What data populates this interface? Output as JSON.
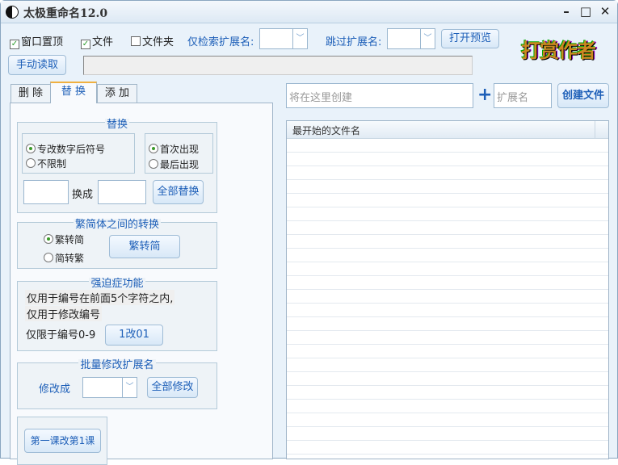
{
  "window": {
    "title": "太极重命名12.0",
    "min": "–",
    "max": "□",
    "close": "✕"
  },
  "toolbar": {
    "topmost": "窗口置顶",
    "files": "文件",
    "folders": "文件夹",
    "only_ext_label": "仅检索扩展名:",
    "skip_ext_label": "跳过扩展名:",
    "preview_btn": "打开预览",
    "manual_read": "手动读取",
    "donate": "打赏作者"
  },
  "tabs": [
    "删 除",
    "替 换",
    "添 加"
  ],
  "replace": {
    "title": "替换",
    "opt1": "专改数字后符号",
    "opt2": "不限制",
    "opt3": "首次出现",
    "opt4": "最后出现",
    "to": "换成",
    "btn": "全部替换"
  },
  "convert": {
    "title": "繁简体之间的转换",
    "opt1": "繁转简",
    "opt2": "简转繁",
    "btn": "繁转简"
  },
  "ocd": {
    "title": "强迫症功能",
    "line1": "仅用于编号在前面5个字符之内,",
    "line2": "仅用于修改编号",
    "limit": "仅限于编号0-9",
    "btn": "1改01"
  },
  "ext": {
    "title": "批量修改扩展名",
    "label": "修改成",
    "btn": "全部修改"
  },
  "lesson": {
    "btn": "第一课改第1课"
  },
  "create": {
    "placeholder": "将在这里创建",
    "plus": "+",
    "ext_placeholder": "扩展名",
    "btn": "创建文件"
  },
  "list": {
    "header": "最开始的文件名"
  }
}
